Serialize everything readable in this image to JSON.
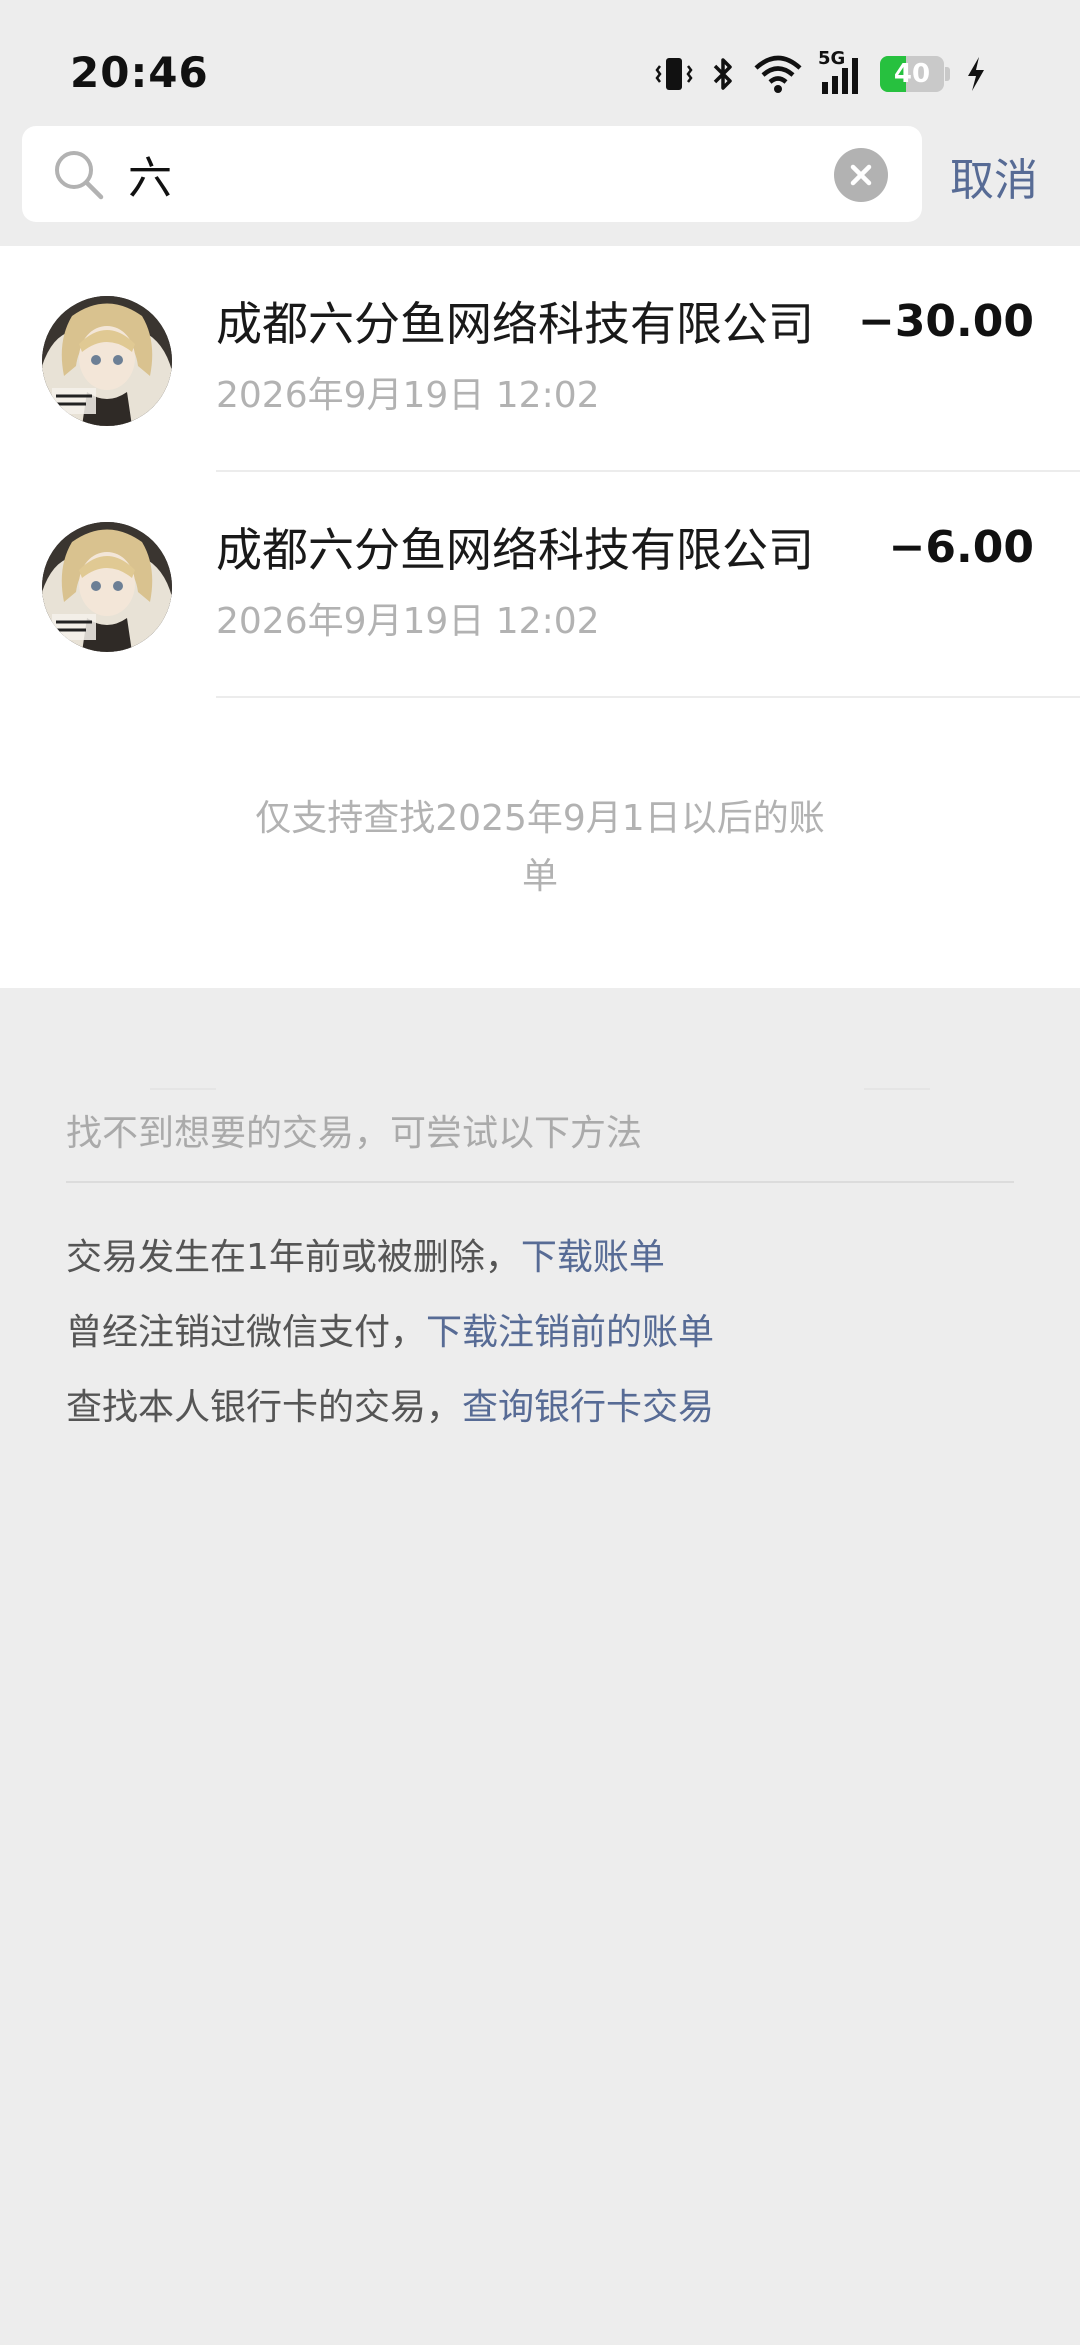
{
  "status_bar": {
    "time": "20:46",
    "network": "5G",
    "battery_level": "40",
    "icons": [
      "vibrate-icon",
      "bluetooth-icon",
      "wifi-icon",
      "signal-icon",
      "battery-icon",
      "charging-icon"
    ]
  },
  "search": {
    "query": "六",
    "cancel_label": "取消"
  },
  "transactions": [
    {
      "merchant": "成都六分鱼网络科技有限公司",
      "date": "2026年9月19日 12:02",
      "amount": "−30.00"
    },
    {
      "merchant": "成都六分鱼网络科技有限公司",
      "date": "2026年9月19日 12:02",
      "amount": "−6.00"
    }
  ],
  "range_note": "仅支持查找2025年9月1日以后的账单",
  "help": {
    "title": "找不到想要的交易，可尝试以下方法",
    "items": [
      {
        "text": "交易发生在1年前或被删除，",
        "link": "下载账单"
      },
      {
        "text": "曾经注销过微信支付，",
        "link": "下载注销前的账单"
      },
      {
        "text": "查找本人银行卡的交易，",
        "link": "查询银行卡交易"
      }
    ]
  },
  "colors": {
    "link": "#576b95",
    "background": "#ededed",
    "battery_fill": "#27c13f"
  }
}
